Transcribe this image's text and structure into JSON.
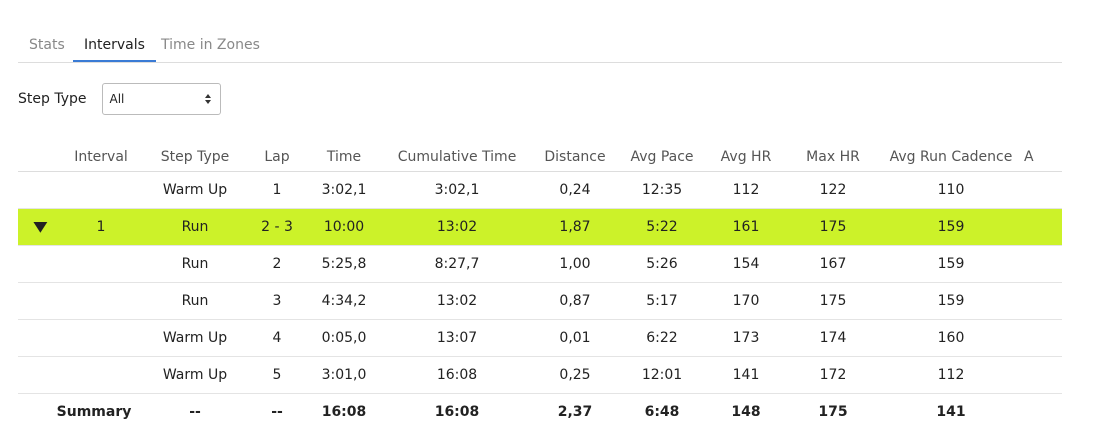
{
  "tabs": [
    {
      "label": "Stats",
      "active": false
    },
    {
      "label": "Intervals",
      "active": true
    },
    {
      "label": "Time in Zones",
      "active": false
    }
  ],
  "step_filter": {
    "label": "Step Type",
    "selected": "All"
  },
  "table": {
    "columns": [
      "",
      "Interval",
      "Step Type",
      "Lap",
      "Time",
      "Cumulative Time",
      "Distance",
      "Avg Pace",
      "Avg HR",
      "Max HR",
      "Avg Run Cadence",
      "A"
    ],
    "rows": [
      {
        "expander": "",
        "cells": [
          "",
          "Warm Up",
          "1",
          "3:02,1",
          "3:02,1",
          "0,24",
          "12:35",
          "112",
          "122",
          "110",
          ""
        ]
      },
      {
        "expander": "▼",
        "highlight": true,
        "cells": [
          "1",
          "Run",
          "2 - 3",
          "10:00",
          "13:02",
          "1,87",
          "5:22",
          "161",
          "175",
          "159",
          ""
        ]
      },
      {
        "expander": "",
        "cells": [
          "",
          "Run",
          "2",
          "5:25,8",
          "8:27,7",
          "1,00",
          "5:26",
          "154",
          "167",
          "159",
          ""
        ]
      },
      {
        "expander": "",
        "cells": [
          "",
          "Run",
          "3",
          "4:34,2",
          "13:02",
          "0,87",
          "5:17",
          "170",
          "175",
          "159",
          ""
        ]
      },
      {
        "expander": "",
        "cells": [
          "",
          "Warm Up",
          "4",
          "0:05,0",
          "13:07",
          "0,01",
          "6:22",
          "173",
          "174",
          "160",
          ""
        ]
      },
      {
        "expander": "",
        "cells": [
          "",
          "Warm Up",
          "5",
          "3:01,0",
          "16:08",
          "0,25",
          "12:01",
          "141",
          "172",
          "112",
          ""
        ]
      }
    ],
    "summary": {
      "label": "Summary",
      "cells": [
        "--",
        "--",
        "16:08",
        "16:08",
        "2,37",
        "6:48",
        "148",
        "175",
        "141",
        ""
      ]
    }
  },
  "colors": {
    "highlight_row": "#ccf229",
    "active_tab_underline": "#3a7bd5"
  }
}
